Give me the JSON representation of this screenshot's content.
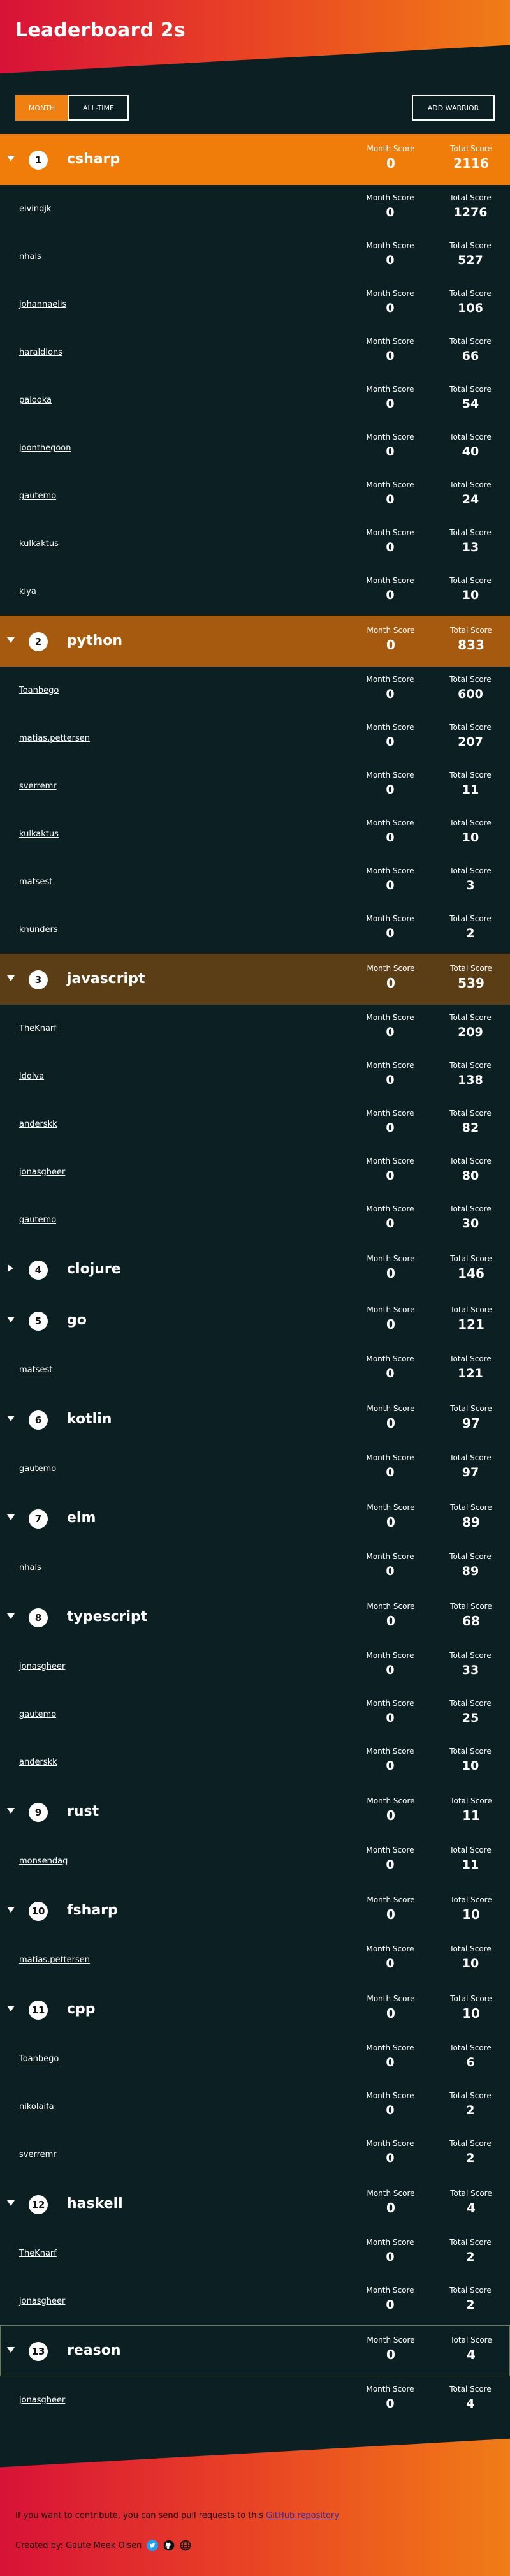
{
  "header": {
    "title": "Leaderboard 2s"
  },
  "controls": {
    "month_label": "MONTH",
    "alltime_label": "ALL-TIME",
    "add_label": "ADD WARRIOR"
  },
  "labels": {
    "month": "Month Score",
    "total": "Total Score"
  },
  "colors": {
    "row1": "#f07d09",
    "row2": "#a65a10",
    "row3": "#5b3d16"
  },
  "languages": [
    {
      "rank": "1",
      "name": "csharp",
      "month": "0",
      "total": "2116",
      "expanded": true,
      "color": "#f07d09",
      "users": [
        {
          "name": "eivindjk",
          "month": "0",
          "total": "1276"
        },
        {
          "name": "nhals",
          "month": "0",
          "total": "527"
        },
        {
          "name": "johannaelis",
          "month": "0",
          "total": "106"
        },
        {
          "name": "haraldlons",
          "month": "0",
          "total": "66"
        },
        {
          "name": "palooka",
          "month": "0",
          "total": "54"
        },
        {
          "name": "joonthegoon",
          "month": "0",
          "total": "40"
        },
        {
          "name": "gautemo",
          "month": "0",
          "total": "24"
        },
        {
          "name": "kulkaktus",
          "month": "0",
          "total": "13"
        },
        {
          "name": "kiya",
          "month": "0",
          "total": "10"
        }
      ]
    },
    {
      "rank": "2",
      "name": "python",
      "month": "0",
      "total": "833",
      "expanded": true,
      "color": "#a65a10",
      "users": [
        {
          "name": "Toanbego",
          "month": "0",
          "total": "600"
        },
        {
          "name": "matias.pettersen",
          "month": "0",
          "total": "207"
        },
        {
          "name": "sverremr",
          "month": "0",
          "total": "11"
        },
        {
          "name": "kulkaktus",
          "month": "0",
          "total": "10"
        },
        {
          "name": "matsest",
          "month": "0",
          "total": "3"
        },
        {
          "name": "knunders",
          "month": "0",
          "total": "2"
        }
      ]
    },
    {
      "rank": "3",
      "name": "javascript",
      "month": "0",
      "total": "539",
      "expanded": true,
      "color": "#5b3d16",
      "users": [
        {
          "name": "TheKnarf",
          "month": "0",
          "total": "209"
        },
        {
          "name": "ldolva",
          "month": "0",
          "total": "138"
        },
        {
          "name": "anderskk",
          "month": "0",
          "total": "82"
        },
        {
          "name": "jonasgheer",
          "month": "0",
          "total": "80"
        },
        {
          "name": "gautemo",
          "month": "0",
          "total": "30"
        }
      ]
    },
    {
      "rank": "4",
      "name": "clojure",
      "month": "0",
      "total": "146",
      "expanded": false,
      "color": "",
      "users": []
    },
    {
      "rank": "5",
      "name": "go",
      "month": "0",
      "total": "121",
      "expanded": true,
      "color": "",
      "users": [
        {
          "name": "matsest",
          "month": "0",
          "total": "121"
        }
      ]
    },
    {
      "rank": "6",
      "name": "kotlin",
      "month": "0",
      "total": "97",
      "expanded": true,
      "color": "",
      "users": [
        {
          "name": "gautemo",
          "month": "0",
          "total": "97"
        }
      ]
    },
    {
      "rank": "7",
      "name": "elm",
      "month": "0",
      "total": "89",
      "expanded": true,
      "color": "",
      "users": [
        {
          "name": "nhals",
          "month": "0",
          "total": "89"
        }
      ]
    },
    {
      "rank": "8",
      "name": "typescript",
      "month": "0",
      "total": "68",
      "expanded": true,
      "color": "",
      "users": [
        {
          "name": "jonasgheer",
          "month": "0",
          "total": "33"
        },
        {
          "name": "gautemo",
          "month": "0",
          "total": "25"
        },
        {
          "name": "anderskk",
          "month": "0",
          "total": "10"
        }
      ]
    },
    {
      "rank": "9",
      "name": "rust",
      "month": "0",
      "total": "11",
      "expanded": true,
      "color": "",
      "users": [
        {
          "name": "monsendag",
          "month": "0",
          "total": "11"
        }
      ]
    },
    {
      "rank": "10",
      "name": "fsharp",
      "month": "0",
      "total": "10",
      "expanded": true,
      "color": "",
      "users": [
        {
          "name": "matias.pettersen",
          "month": "0",
          "total": "10"
        }
      ]
    },
    {
      "rank": "11",
      "name": "cpp",
      "month": "0",
      "total": "10",
      "expanded": true,
      "color": "",
      "users": [
        {
          "name": "Toanbego",
          "month": "0",
          "total": "6"
        },
        {
          "name": "nikolaifa",
          "month": "0",
          "total": "2"
        },
        {
          "name": "sverremr",
          "month": "0",
          "total": "2"
        }
      ]
    },
    {
      "rank": "12",
      "name": "haskell",
      "month": "0",
      "total": "4",
      "expanded": true,
      "color": "",
      "users": [
        {
          "name": "TheKnarf",
          "month": "0",
          "total": "2"
        },
        {
          "name": "jonasgheer",
          "month": "0",
          "total": "2"
        }
      ]
    },
    {
      "rank": "13",
      "name": "reason",
      "month": "0",
      "total": "4",
      "expanded": true,
      "color": "",
      "outlined": true,
      "users": [
        {
          "name": "jonasgheer",
          "month": "0",
          "total": "4"
        }
      ]
    }
  ],
  "footer": {
    "contrib_text": "If you want to contribute, you can send pull requests to this ",
    "link_text": "GitHub repository",
    "credit": "Created by: Gaute Meek Olsen",
    "icons": [
      "twitter-icon",
      "github-icon",
      "globe-icon"
    ]
  }
}
